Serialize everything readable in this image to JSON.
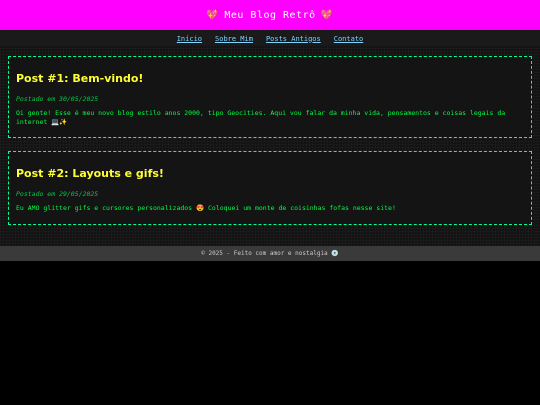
{
  "header": {
    "title": "Meu Blog Retrô",
    "heart_icon": "💖"
  },
  "nav": {
    "items": [
      "Início",
      "Sobre Mim",
      "Posts Antigos",
      "Contato"
    ]
  },
  "posts": [
    {
      "title": "Post #1: Bem-vindo!",
      "date": "Postado em 30/05/2025",
      "body": "Oi gente! Esse é meu novo blog estilo anos 2000, tipo Geocities. Aqui vou falar da minha vida, pensamentos e coisas legais da internet 💻✨"
    },
    {
      "title": "Post #2: Layouts e gifs!",
      "date": "Postado em 29/05/2025",
      "body": "Eu AMO glitter gifs e cursores personalizados 😍 Coloquei um monte de coisinhas fofas nesse site!"
    }
  ],
  "footer": {
    "text": "© 2025 - Feito com amor e nostalgia 💿"
  },
  "colors": {
    "header_bg": "#ff00ff",
    "post_border": "#00ff99",
    "post_title": "#ffff33",
    "post_text": "#00ff44",
    "nav_link": "#7fd4ff"
  }
}
